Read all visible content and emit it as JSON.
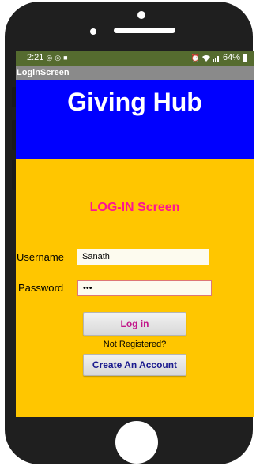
{
  "status_bar": {
    "time": "2:21",
    "left_icons": [
      "whatsapp-icon",
      "whatsapp-icon",
      "message-icon"
    ],
    "right_icons": [
      "alarm-icon",
      "wifi-icon",
      "signal-icon",
      "battery-icon"
    ],
    "battery": "64%"
  },
  "title_bar": {
    "title": "LoginScreen"
  },
  "banner": {
    "title": "Giving Hub",
    "color": "#0000ff"
  },
  "heading": {
    "text": "LOG-IN Screen",
    "color": "#ff1493"
  },
  "form": {
    "username_label": "Username",
    "username_value": "Sanath",
    "password_label": "Password",
    "password_value": "•••"
  },
  "buttons": {
    "login_label": "Log in",
    "not_registered": "Not Registered?",
    "create_label": "Create An Account"
  },
  "colors": {
    "screen_bg": "#ffc600",
    "status_bar": "#556b2f",
    "title_bar": "#8a8a8a"
  }
}
